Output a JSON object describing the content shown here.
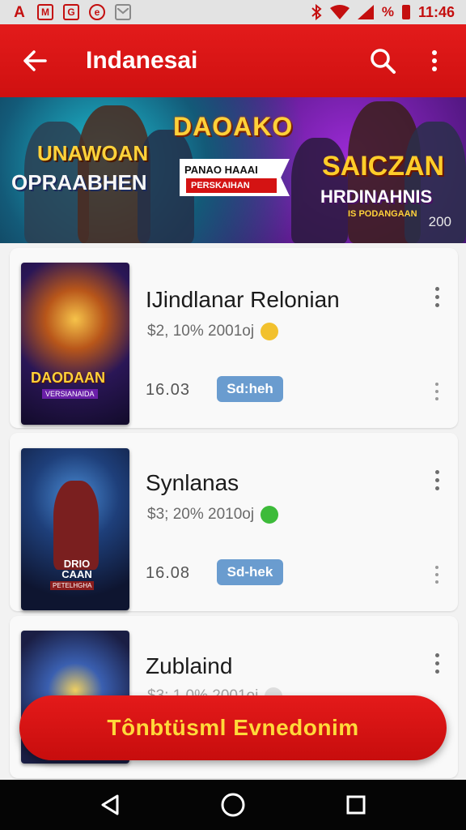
{
  "status_bar": {
    "notifications": [
      "A",
      "M",
      "G",
      "e",
      "mail"
    ],
    "battery_text": "%",
    "time": "11:46"
  },
  "app_bar": {
    "title": "Indanesai",
    "back_icon": "arrow-left-icon",
    "search_icon": "search-icon",
    "more_icon": "more-vert-icon"
  },
  "banner": {
    "logo_main": "DAOAKO",
    "left_line1": "UNAWOAN",
    "left_line2": "OPRAABHEN",
    "ribbon_line1": "PANAO HAAAI",
    "ribbon_line2": "PERSKAIHAN",
    "right_line1": "SAICZAN",
    "right_line2": "HRDINAHNIS",
    "right_line3": "IS PODANGAAN",
    "year": "200"
  },
  "items": [
    {
      "name": "IJindlanar Relonian",
      "meta": "$2, 10% 2001oj",
      "emoji_color": "#f2c12e",
      "price": "16.03",
      "badge": "Sd:heh",
      "cover_title": "DAODAAN",
      "cover_sub": "VERSIANAIDA"
    },
    {
      "name": "Synlanas",
      "meta": "$3; 20% 2010oj",
      "emoji_color": "#3dbb3a",
      "price": "16.08",
      "badge": "Sd-hek",
      "cover_title": "DRIO CAAN",
      "cover_sub": "PETELHGHA"
    },
    {
      "name": "Zublaind",
      "meta": "$3; 1.0% 2001oj",
      "emoji_color": "#cccccc",
      "price": "",
      "badge": "",
      "cover_title": "",
      "cover_sub": ""
    }
  ],
  "fab": {
    "label": "Tônbtüsml Evnedonim"
  },
  "nav_bar": {
    "back_icon": "triangle-back-icon",
    "home_icon": "circle-home-icon",
    "recents_icon": "square-recents-icon"
  },
  "colors": {
    "primary_red": "#d81414",
    "badge_blue": "#6a9ccf",
    "fab_text_yellow": "#ffd93a"
  }
}
